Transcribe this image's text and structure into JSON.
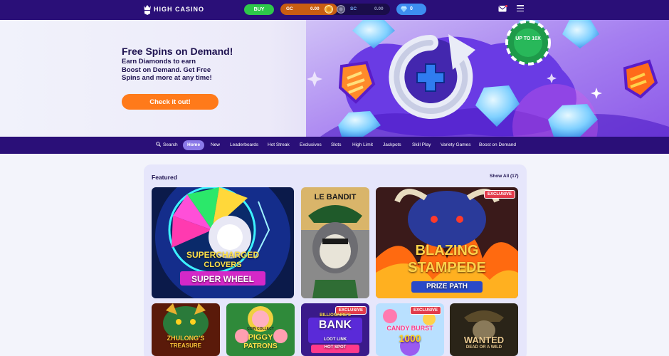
{
  "header": {
    "logo": "HIGH CASINO",
    "buy_label": "BUY",
    "gc": {
      "label": "GC",
      "value": "0.00"
    },
    "sc": {
      "label": "SC",
      "value": "0.00"
    },
    "diamonds": "0",
    "icons": [
      "logo-icon",
      "gc-coin-icon",
      "sc-coin-icon",
      "diamond-icon",
      "mail-icon",
      "hamburger-menu-icon"
    ]
  },
  "hero": {
    "title": "Free Spins on Demand!",
    "text": "Earn Diamonds to earn Boost on Demand. Get Free Spins and more at any time!",
    "cta": "Check it out!",
    "badge_chip": "UP TO 10X"
  },
  "nav": {
    "search": "Search",
    "items": [
      "Home",
      "New",
      "Leaderboards",
      "Hot Streak",
      "Exclusives",
      "Slots",
      "High Limit",
      "Jackpots",
      "Skill Play",
      "Variety Games",
      "Boost on Demand"
    ],
    "active": "Home"
  },
  "featured": {
    "title": "Featured",
    "show_all": "Show All (17)",
    "exclusive_label": "EXCLUSIVE",
    "games": [
      {
        "name": "4 Supercharged Clovers Super Wheel",
        "l1": "SUPERCHARGED",
        "l2": "CLOVERS",
        "l3": "SUPER WHEEL"
      },
      {
        "name": "Le Bandit",
        "l1": "LE BANDIT"
      },
      {
        "name": "Blazing Stampede Prize Path",
        "l1": "BLAZING",
        "l2": "STAMPEDE",
        "l3": "PRIZE PATH",
        "exclusive": true
      },
      {
        "name": "Zhulong's Treasure",
        "l1": "ZHULONG'S",
        "l2": "TREASURE"
      },
      {
        "name": "Coin Collect Piggy Patrons",
        "l0": "COIN COLLECT",
        "l1": "PIGGY",
        "l2": "PATRONS"
      },
      {
        "name": "Power Billionaire's Bank Loot Link Hot Spot",
        "l0": "BILLIONAIRE'S",
        "l1": "BANK",
        "l2": "LOOT LINK",
        "l3": "HOT SPOT",
        "exclusive": true
      },
      {
        "name": "Candy Burst 1000",
        "l1": "CANDY BURST",
        "l2": "1000",
        "exclusive": true
      },
      {
        "name": "Wanted Dead or a Wild",
        "l1": "WANTED",
        "l2": "DEAD OR A WILD"
      }
    ]
  },
  "colors": {
    "topbar": "#2a0f78",
    "buy": "#2ec84a",
    "cta": "#ff7a1a",
    "exclusive": "#e23b4b",
    "nav_active": "#8b7ae8"
  }
}
